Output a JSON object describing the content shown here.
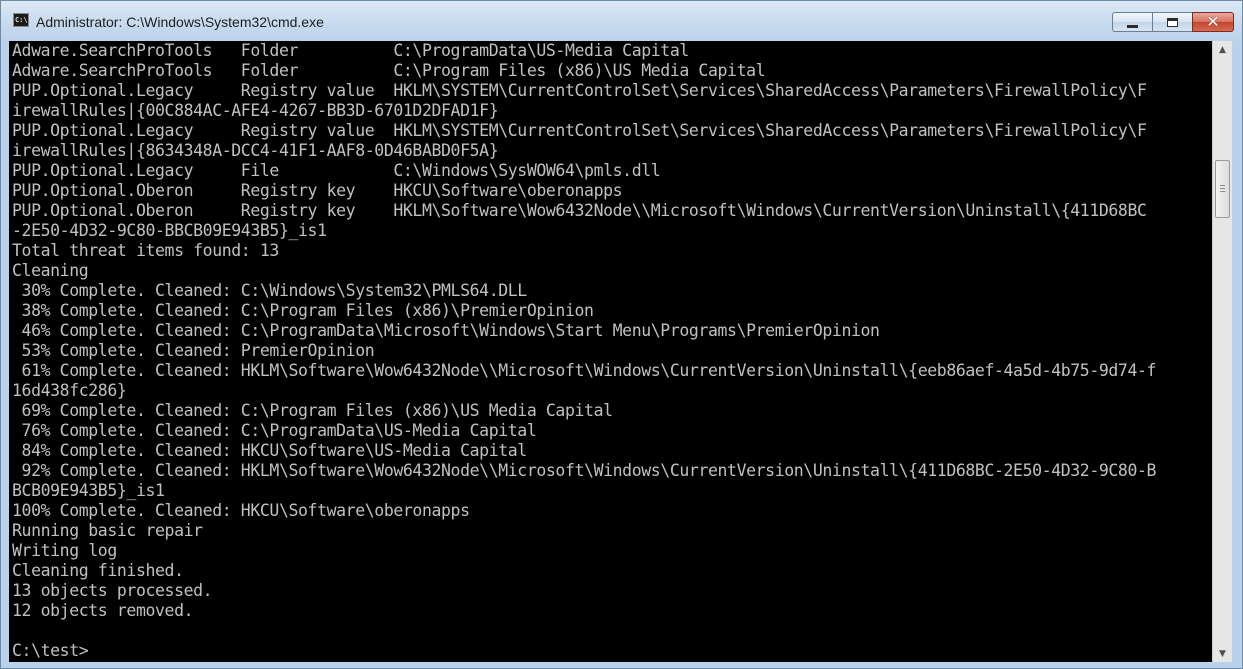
{
  "window": {
    "title": "Administrator: C:\\Windows\\System32\\cmd.exe",
    "app_icon_text": "C:\\",
    "controls": {
      "minimize": "minimize",
      "maximize": "maximize",
      "close": "✕"
    }
  },
  "console": {
    "lines": [
      "Adware.SearchProTools   Folder          C:\\ProgramData\\US-Media Capital",
      "Adware.SearchProTools   Folder          C:\\Program Files (x86)\\US Media Capital",
      "PUP.Optional.Legacy     Registry value  HKLM\\SYSTEM\\CurrentControlSet\\Services\\SharedAccess\\Parameters\\FirewallPolicy\\F",
      "irewallRules|{00C884AC-AFE4-4267-BB3D-6701D2DFAD1F}",
      "PUP.Optional.Legacy     Registry value  HKLM\\SYSTEM\\CurrentControlSet\\Services\\SharedAccess\\Parameters\\FirewallPolicy\\F",
      "irewallRules|{8634348A-DCC4-41F1-AAF8-0D46BABD0F5A}",
      "PUP.Optional.Legacy     File            C:\\Windows\\SysWOW64\\pmls.dll",
      "PUP.Optional.Oberon     Registry key    HKCU\\Software\\oberonapps",
      "PUP.Optional.Oberon     Registry key    HKLM\\Software\\Wow6432Node\\\\Microsoft\\Windows\\CurrentVersion\\Uninstall\\{411D68BC",
      "-2E50-4D32-9C80-BBCB09E943B5}_is1",
      "Total threat items found: 13",
      "Cleaning",
      " 30% Complete. Cleaned: C:\\Windows\\System32\\PMLS64.DLL",
      " 38% Complete. Cleaned: C:\\Program Files (x86)\\PremierOpinion",
      " 46% Complete. Cleaned: C:\\ProgramData\\Microsoft\\Windows\\Start Menu\\Programs\\PremierOpinion",
      " 53% Complete. Cleaned: PremierOpinion",
      " 61% Complete. Cleaned: HKLM\\Software\\Wow6432Node\\\\Microsoft\\Windows\\CurrentVersion\\Uninstall\\{eeb86aef-4a5d-4b75-9d74-f",
      "16d438fc286}",
      " 69% Complete. Cleaned: C:\\Program Files (x86)\\US Media Capital",
      " 76% Complete. Cleaned: C:\\ProgramData\\US-Media Capital",
      " 84% Complete. Cleaned: HKCU\\Software\\US-Media Capital",
      " 92% Complete. Cleaned: HKLM\\Software\\Wow6432Node\\\\Microsoft\\Windows\\CurrentVersion\\Uninstall\\{411D68BC-2E50-4D32-9C80-B",
      "BCB09E943B5}_is1",
      "100% Complete. Cleaned: HKCU\\Software\\oberonapps",
      "Running basic repair",
      "Writing log",
      "Cleaning finished.",
      "13 objects processed.",
      "12 objects removed.",
      "",
      "C:\\test>"
    ]
  },
  "scrollbar": {
    "up_arrow": "▲",
    "down_arrow": "▼"
  }
}
